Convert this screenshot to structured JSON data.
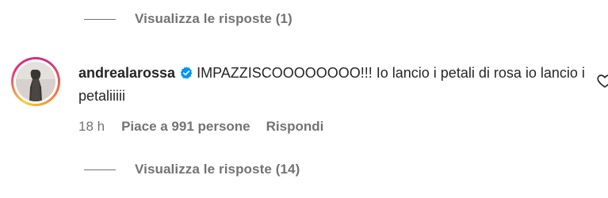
{
  "replies_top": {
    "label": "Visualizza le risposte (1)"
  },
  "comment": {
    "username": "andrealarossa",
    "text": "IMPAZZISCOOOOOOOO!!! Io lancio i petali di rosa io lancio i petaliiiii",
    "time": "18 h",
    "likes": "Piace a 991 persone",
    "reply": "Rispondi"
  },
  "replies_bottom": {
    "label": "Visualizza le risposte (14)"
  },
  "icons": {
    "verified": "verified-badge-icon",
    "like": "heart-icon",
    "avatar": "profile-photo"
  },
  "colors": {
    "verified": "#0095f6",
    "secondary_text": "#737373",
    "primary_text": "#262626"
  }
}
